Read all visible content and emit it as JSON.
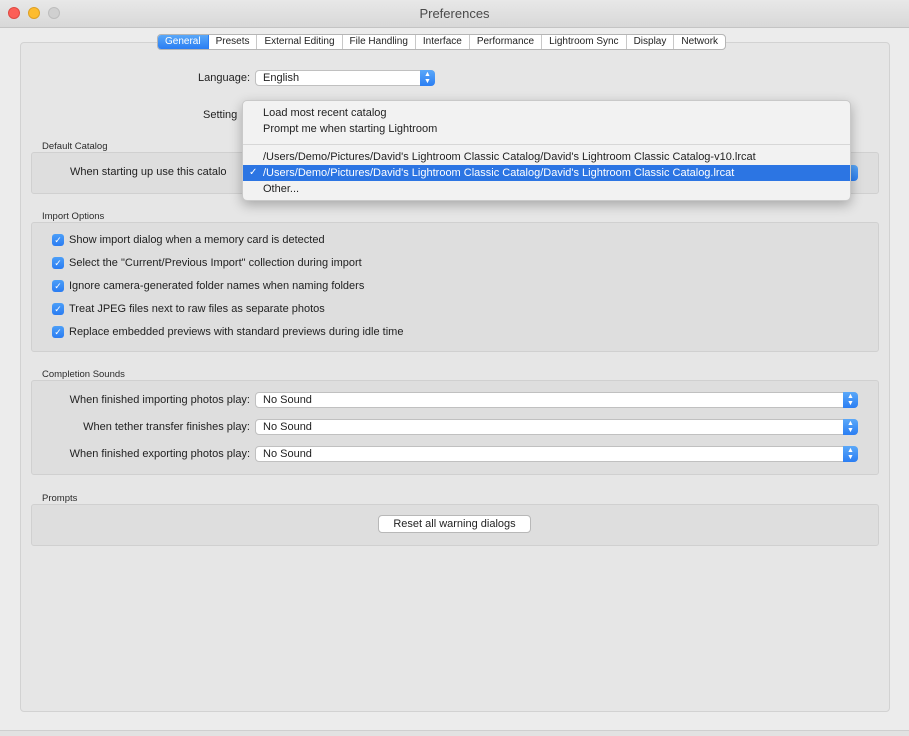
{
  "window": {
    "title": "Preferences"
  },
  "tabs": [
    {
      "label": "General",
      "active": true
    },
    {
      "label": "Presets"
    },
    {
      "label": "External Editing"
    },
    {
      "label": "File Handling"
    },
    {
      "label": "Interface"
    },
    {
      "label": "Performance"
    },
    {
      "label": "Lightroom Sync"
    },
    {
      "label": "Display"
    },
    {
      "label": "Network"
    }
  ],
  "language": {
    "label": "Language:",
    "value": "English"
  },
  "settings": {
    "label": "Setting"
  },
  "default_catalog": {
    "title": "Default Catalog",
    "label": "When starting up use this catalo"
  },
  "catalog_dropdown": {
    "items": [
      "Load most recent catalog",
      "Prompt me when starting Lightroom",
      "/Users/Demo/Pictures/David's Lightroom Classic Catalog/David's Lightroom Classic Catalog-v10.lrcat",
      "/Users/Demo/Pictures/David's Lightroom Classic Catalog/David's Lightroom Classic Catalog.lrcat",
      "Other..."
    ],
    "selected_index": 3,
    "check": "✓"
  },
  "import_options": {
    "title": "Import Options",
    "items": [
      "Show import dialog when a memory card is detected",
      "Select the \"Current/Previous Import\" collection during import",
      "Ignore camera-generated folder names when naming folders",
      "Treat JPEG files next to raw files as separate photos",
      "Replace embedded previews with standard previews during idle time"
    ]
  },
  "completion_sounds": {
    "title": "Completion Sounds",
    "rows": [
      {
        "label": "When finished importing photos play:",
        "value": "No Sound"
      },
      {
        "label": "When tether transfer finishes play:",
        "value": "No Sound"
      },
      {
        "label": "When finished exporting photos play:",
        "value": "No Sound"
      }
    ]
  },
  "prompts": {
    "title": "Prompts",
    "reset_label": "Reset all warning dialogs"
  },
  "colors": {
    "accent": "#2c75e3"
  }
}
